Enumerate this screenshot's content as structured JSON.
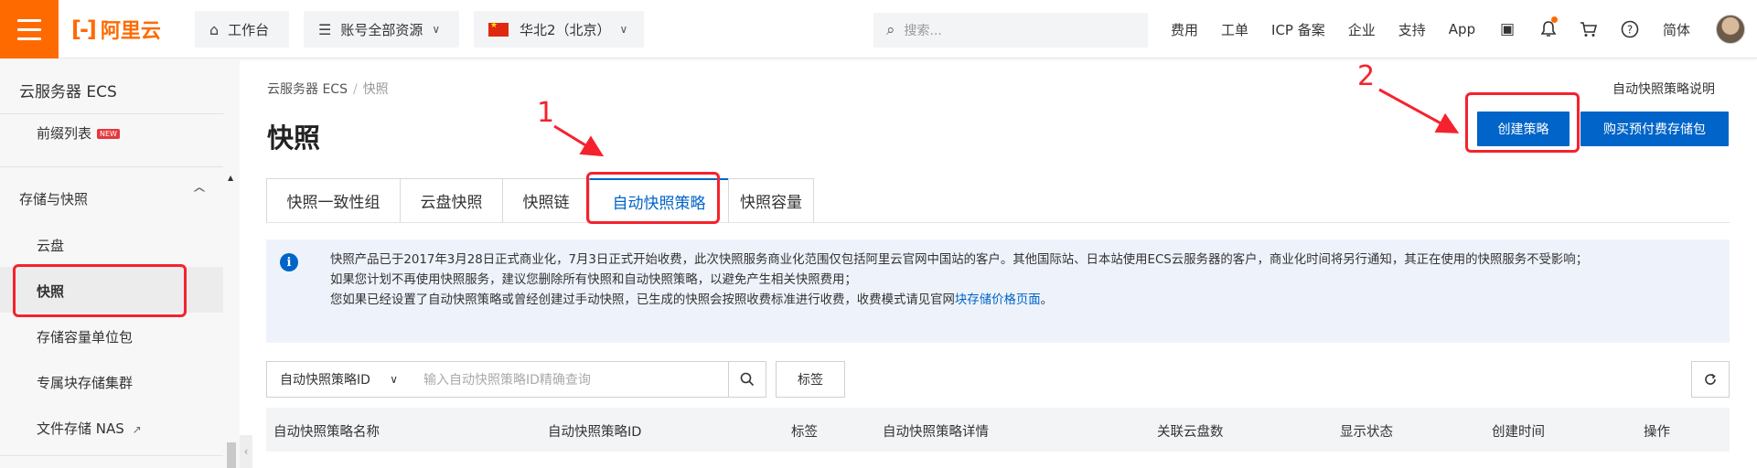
{
  "topbar": {
    "logo_text": "阿里云",
    "workbench": "工作台",
    "resources": "账号全部资源",
    "region": "华北2（北京）",
    "search_placeholder": "搜索...",
    "links": [
      "费用",
      "工单",
      "ICP 备案",
      "企业",
      "支持",
      "App"
    ],
    "language": "简体"
  },
  "sidebar": {
    "title": "云服务器 ECS",
    "prefix_list": "前缀列表",
    "new_badge": "NEW",
    "group": "存储与快照",
    "items": [
      "云盘",
      "快照",
      "存储容量单位包",
      "专属块存储集群",
      "文件存储 NAS"
    ]
  },
  "breadcrumb": {
    "root": "云服务器 ECS",
    "current": "快照"
  },
  "page": {
    "title": "快照",
    "help_link": "自动快照策略说明",
    "create_button": "创建策略",
    "buy_button": "购买预付费存储包"
  },
  "tabs": [
    "快照一致性组",
    "云盘快照",
    "快照链",
    "自动快照策略",
    "快照容量"
  ],
  "notice": {
    "line1": "快照产品已于2017年3月28日正式商业化，7月3日正式开始收费，此次快照服务商业化范围仅包括阿里云官网中国站的客户。其他国际站、日本站使用ECS云服务器的客户，商业化时间将另行通知，其正在使用的快照服务不受影响；",
    "line2": "如果您计划不再使用快照服务，建议您删除所有快照和自动快照策略，以避免产生相关快照费用；",
    "line3_prefix": "您如果已经设置了自动快照策略或曾经创建过手动快照，已生成的快照会按照收费标准进行收费，收费模式请见官网",
    "line3_link": "块存储价格页面",
    "line3_suffix": "。"
  },
  "filter": {
    "select_value": "自动快照策略ID",
    "input_placeholder": "输入自动快照策略ID精确查询",
    "tag_button": "标签"
  },
  "table": {
    "headers": [
      "自动快照策略名称",
      "自动快照策略ID",
      "标签",
      "自动快照策略详情",
      "关联云盘数",
      "显示状态",
      "创建时间",
      "操作"
    ]
  },
  "annotations": {
    "step1": "1",
    "step2": "2"
  },
  "colors": {
    "brand": "#ff6a00",
    "primary": "#0064c8",
    "annotation": "#f5222d",
    "notice_bg": "#eef3fb"
  }
}
